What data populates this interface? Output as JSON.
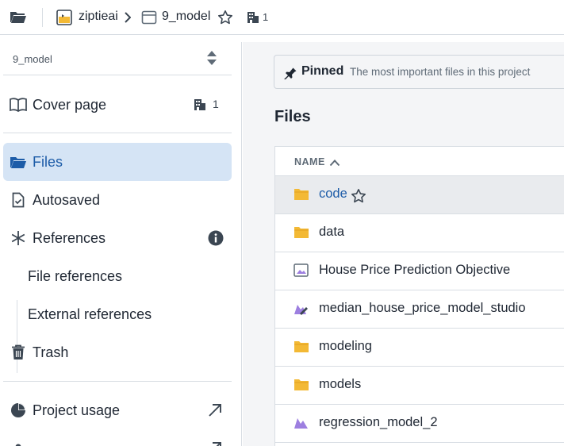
{
  "topbar": {
    "workspace": "ziptieai",
    "project": "9_model",
    "spaces_count": "1"
  },
  "sidebar": {
    "project_name": "9_model",
    "cover_page": "Cover page",
    "cover_count": "1",
    "items": [
      {
        "label": "Files"
      },
      {
        "label": "Autosaved"
      },
      {
        "label": "References"
      },
      {
        "label": "File references"
      },
      {
        "label": "External references"
      },
      {
        "label": "Trash"
      },
      {
        "label": "Project usage"
      }
    ]
  },
  "main": {
    "pinned_title": "Pinned",
    "pinned_desc": "The most important files in this project",
    "files_title": "Files",
    "column_name": "NAME",
    "rows": [
      {
        "name": "code",
        "icon": "folder-icon"
      },
      {
        "name": "data",
        "icon": "folder-icon"
      },
      {
        "name": "House Price Prediction Objective",
        "icon": "image-icon"
      },
      {
        "name": "median_house_price_model_studio",
        "icon": "model-studio-icon"
      },
      {
        "name": "modeling",
        "icon": "folder-icon"
      },
      {
        "name": "models",
        "icon": "folder-icon"
      },
      {
        "name": "regression_model_2",
        "icon": "model-icon"
      }
    ]
  },
  "colors": {
    "accent": "#1d5ca8",
    "active_bg": "#d5e4f5",
    "folder": "#f3b935",
    "model": "#9d7fe0"
  }
}
